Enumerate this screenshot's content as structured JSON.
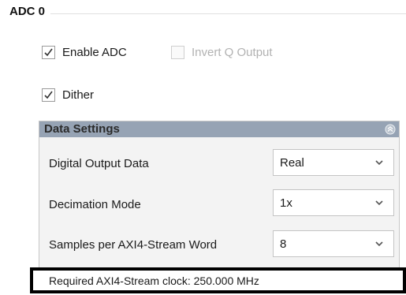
{
  "section": {
    "title": "ADC 0"
  },
  "options": {
    "enable_adc": {
      "label": "Enable ADC",
      "checked": true,
      "enabled": true
    },
    "invert_q": {
      "label": "Invert Q Output",
      "checked": false,
      "enabled": false
    },
    "dither": {
      "label": "Dither",
      "checked": true,
      "enabled": true
    }
  },
  "data_settings": {
    "title": "Data Settings",
    "rows": [
      {
        "label": "Digital Output Data",
        "value": "Real"
      },
      {
        "label": "Decimation Mode",
        "value": "1x"
      },
      {
        "label": "Samples per AXI4-Stream Word",
        "value": "8"
      }
    ]
  },
  "clock": {
    "text": "Required AXI4-Stream clock: 250.000 MHz"
  },
  "colors": {
    "panel_header": "#96a3b4",
    "panel_body": "#f3f3f3",
    "disabled_text": "#b2b2b2"
  },
  "icons": {
    "check": "checkmark-icon",
    "collapse": "collapse-up-icon",
    "dropdown": "chevron-down-icon"
  }
}
